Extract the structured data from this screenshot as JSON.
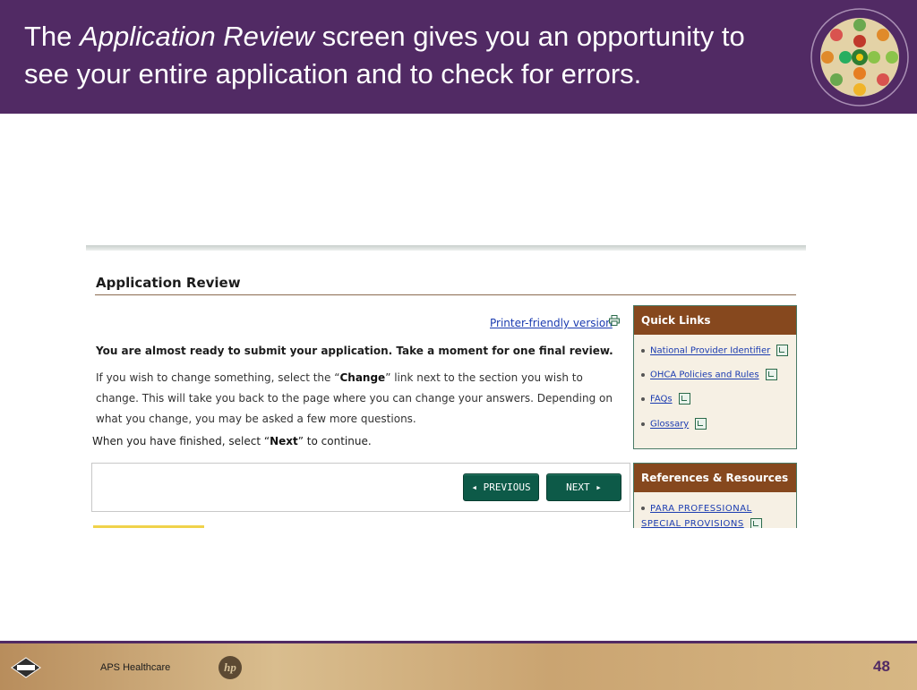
{
  "slide": {
    "title_part1": "The ",
    "title_emphasis": "Application Review",
    "title_part2": " screen gives you an opportunity to see your entire application and to check for errors.",
    "page_number": "48"
  },
  "footer": {
    "aps_label": "APS Healthcare",
    "hp_label": "hp"
  },
  "review": {
    "heading": "Application Review",
    "printer_link": "Printer-friendly version",
    "intro_bold": "You are almost ready to submit your application. Take a moment for one final review.",
    "body_1": "If you wish to change something, select the “",
    "body_change": "Change",
    "body_2": "” link next to the section you wish to change. This will take you back to the page where you can change your answers. Depending on what you change, you may be asked a few more questions.",
    "finish_1": "When you have finished, select “",
    "finish_next": "Next",
    "finish_2": "” to continue.",
    "prev_button": "◂ PREVIOUS",
    "next_button": "NEXT ▸"
  },
  "quick_links": {
    "heading": "Quick Links",
    "items": [
      {
        "label": "National Provider Identifier"
      },
      {
        "label": "OHCA Policies and Rules"
      },
      {
        "label": "FAQs"
      },
      {
        "label": "Glossary"
      }
    ]
  },
  "references": {
    "heading": "References & Resources",
    "item_1": "PARA PROFESSIONAL SPECIAL PROVISIONS"
  },
  "colors": {
    "header_purple": "#512a64",
    "panel_brown": "#86481e",
    "button_green": "#0d5a48",
    "link_blue": "#1a3bb0"
  }
}
